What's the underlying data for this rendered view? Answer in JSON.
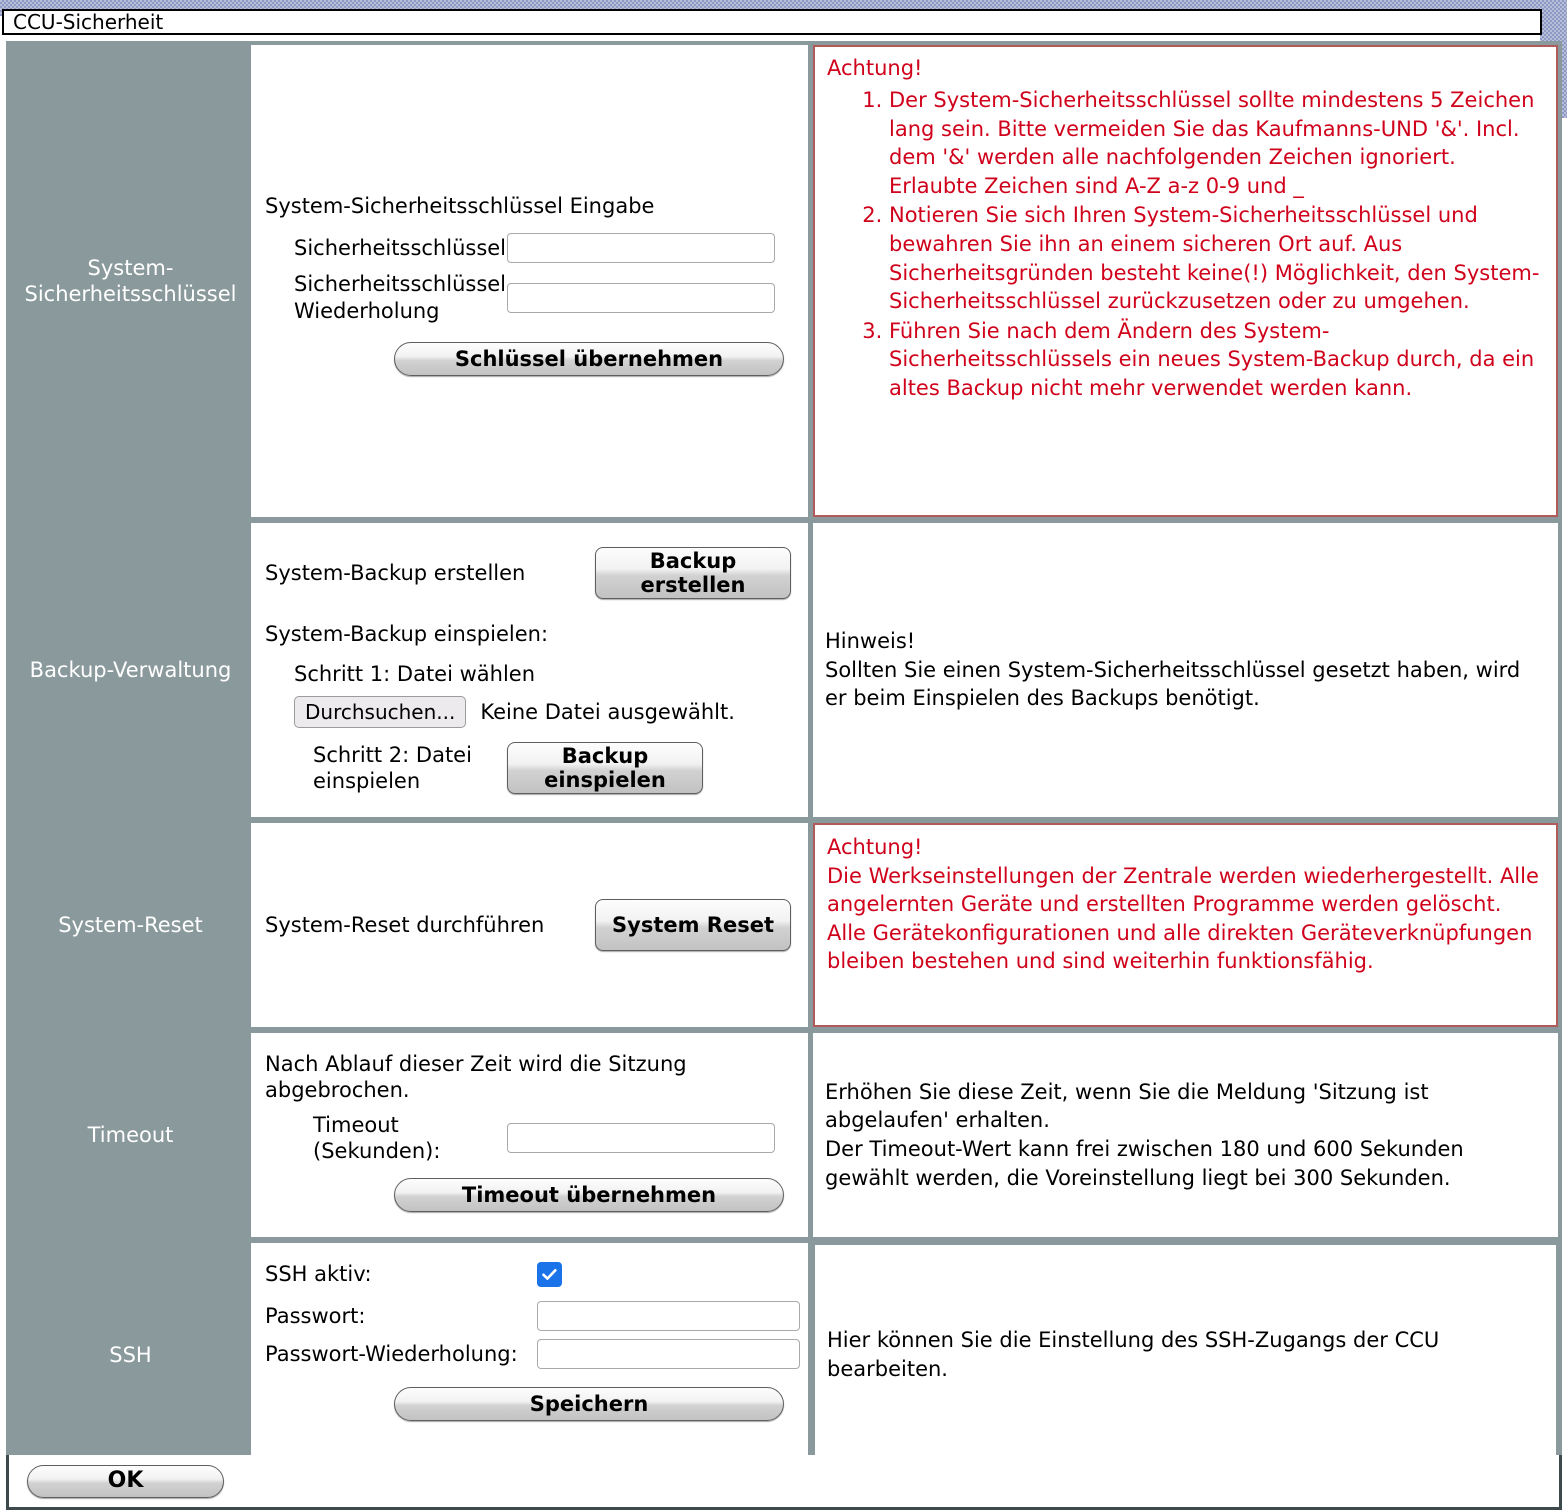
{
  "window": {
    "title": "CCU-Sicherheit"
  },
  "sections": {
    "security_key": {
      "sidebar_label": "System-Sicherheitsschlüssel",
      "heading": "System-Sicherheitsschlüssel Eingabe",
      "field1_label": "Sicherheitsschlüssel",
      "field1_value": "",
      "field2_label": "Sicherheitsschlüssel Wiederholung",
      "field2_value": "",
      "apply_button": "Schlüssel übernehmen",
      "warning_title": "Achtung!",
      "warning_items": [
        "Der System-Sicherheitsschlüssel sollte mindestens 5 Zeichen lang sein. Bitte vermeiden Sie das Kaufmanns-UND '&'. Incl. dem '&' werden alle nachfolgenden Zeichen ignoriert. Erlaubte Zeichen sind A-Z a-z 0-9 und _",
        "Notieren Sie sich Ihren System-Sicherheitsschlüssel und bewahren Sie ihn an einem sicheren Ort auf. Aus Sicherheitsgründen besteht keine(!) Möglichkeit, den System-Sicherheitsschlüssel zurückzusetzen oder zu umgehen.",
        "Führen Sie nach dem Ändern des System-Sicherheitsschlüssels ein neues System-Backup durch, da ein altes Backup nicht mehr verwendet werden kann."
      ]
    },
    "backup": {
      "sidebar_label": "Backup-Verwaltung",
      "create_label": "System-Backup erstellen",
      "create_button": "Backup erstellen",
      "restore_label": "System-Backup einspielen:",
      "step1_label": "Schritt 1: Datei wählen",
      "browse_button": "Durchsuchen...",
      "file_status": "Keine Datei ausgewählt.",
      "step2_label": "Schritt 2: Datei einspielen",
      "restore_button": "Backup einspielen",
      "note_title": "Hinweis!",
      "note_text": "Sollten Sie einen System-Sicherheitsschlüssel gesetzt haben, wird er beim Einspielen des Backups benötigt."
    },
    "system_reset": {
      "sidebar_label": "System-Reset",
      "action_label": "System-Reset durchführen",
      "reset_button": "System Reset",
      "warning_title": "Achtung!",
      "warning_paragraphs": [
        "Die Werkseinstellungen der Zentrale werden wiederhergestellt. Alle angelernten Geräte und erstellten Programme werden gelöscht.",
        "Alle Gerätekonfigurationen und alle direkten Geräteverknüpfungen bleiben bestehen und sind weiterhin funktionsfähig."
      ]
    },
    "timeout": {
      "sidebar_label": "Timeout",
      "description": "Nach Ablauf dieser Zeit wird die Sitzung abgebrochen.",
      "field_label": "Timeout (Sekunden):",
      "field_value": "",
      "apply_button": "Timeout übernehmen",
      "info_paragraphs": [
        "Erhöhen Sie diese Zeit, wenn Sie die Meldung 'Sitzung ist abgelaufen' erhalten.",
        "Der Timeout-Wert kann frei zwischen 180 und 600 Sekunden gewählt werden, die Voreinstellung liegt bei 300 Sekunden."
      ]
    },
    "ssh": {
      "sidebar_label": "SSH",
      "active_label": "SSH aktiv:",
      "active_checked": true,
      "password_label": "Passwort:",
      "password_value": "",
      "password_repeat_label": "Passwort-Wiederholung:",
      "password_repeat_value": "",
      "save_button": "Speichern",
      "info_text": "Hier können Sie die Einstellung des SSH-Zugangs der CCU bearbeiten."
    }
  },
  "footer": {
    "ok_button": "OK"
  },
  "colors": {
    "sidebar_bg": "#8a999b",
    "warning_text": "#d0021b",
    "checkbox_accent": "#1a73e8"
  }
}
